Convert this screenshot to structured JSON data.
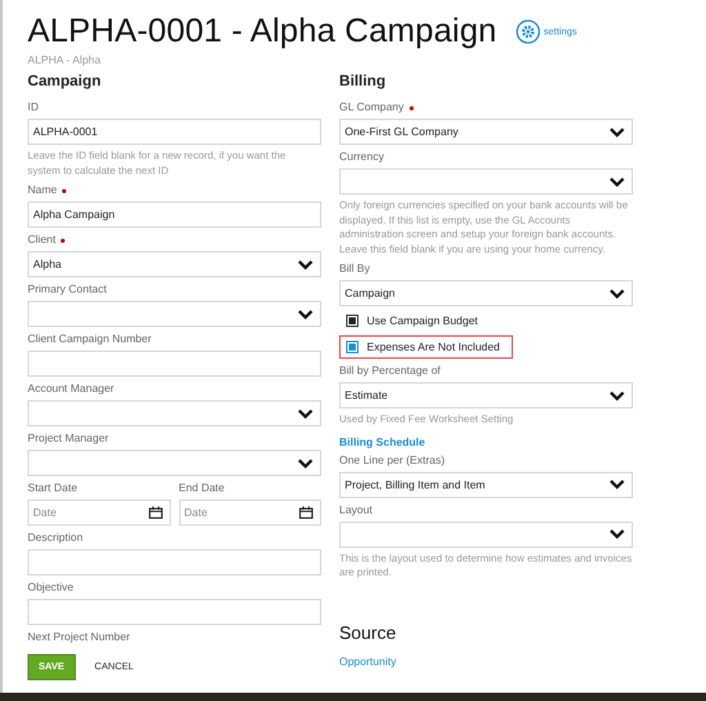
{
  "header": {
    "title": "ALPHA-0001 - Alpha Campaign",
    "settings_label": "settings",
    "subtitle": "ALPHA - Alpha"
  },
  "campaign": {
    "heading": "Campaign",
    "fields": [
      {
        "kind": "input",
        "label": "ID",
        "required": false,
        "value": "ALPHA-0001",
        "hint": "Leave the ID field blank for a new record, if you want the system to calculate the next ID"
      },
      {
        "kind": "input",
        "label": "Name",
        "required": true,
        "value": "Alpha Campaign"
      },
      {
        "kind": "select",
        "label": "Client",
        "required": true,
        "value": "Alpha"
      },
      {
        "kind": "select",
        "label": "Primary Contact",
        "required": false
      },
      {
        "kind": "input",
        "label": "Client Campaign Number",
        "required": false
      },
      {
        "kind": "select",
        "label": "Account Manager",
        "required": false
      },
      {
        "kind": "select",
        "label": "Project Manager",
        "required": false
      },
      {
        "kind": "dates",
        "dates": [
          {
            "label": "Start Date",
            "placeholder": "Date"
          },
          {
            "label": "End Date",
            "placeholder": "Date"
          }
        ]
      },
      {
        "kind": "input",
        "label": "Description",
        "required": false
      },
      {
        "kind": "input",
        "label": "Objective",
        "required": false
      },
      {
        "kind": "label",
        "label": "Next Project Number"
      }
    ]
  },
  "billing": {
    "heading": "Billing",
    "fields": [
      {
        "kind": "select",
        "label": "GL Company",
        "required": true,
        "value": "One-First GL Company"
      },
      {
        "kind": "select",
        "label": "Currency",
        "required": false,
        "hint": "Only foreign currencies specified on your bank accounts will be displayed. If this list is empty, use the GL Accounts administration screen and setup your foreign bank accounts. Leave this field blank if you are using your home currency."
      },
      {
        "kind": "select",
        "label": "Bill By",
        "required": false,
        "value": "Campaign"
      },
      {
        "kind": "checkbox",
        "label": "Use Campaign Budget",
        "checked": true,
        "highlighted": false
      },
      {
        "kind": "checkbox",
        "label": "Expenses Are Not Included",
        "checked": true,
        "highlighted": true
      },
      {
        "kind": "select",
        "label": "Bill by Percentage of",
        "required": false,
        "value": "Estimate",
        "hint": "Used by Fixed Fee Worksheet Setting"
      },
      {
        "kind": "link",
        "label": "Billing Schedule"
      },
      {
        "kind": "select",
        "label": "One Line per (Extras)",
        "required": false,
        "value": "Project, Billing Item and Item"
      },
      {
        "kind": "select",
        "label": "Layout",
        "required": false,
        "hint": "This is the layout used to determine how estimates and invoices are printed."
      }
    ]
  },
  "source": {
    "heading": "Source",
    "link": "Opportunity"
  },
  "buttons": {
    "save": "SAVE",
    "cancel": "CANCEL"
  }
}
